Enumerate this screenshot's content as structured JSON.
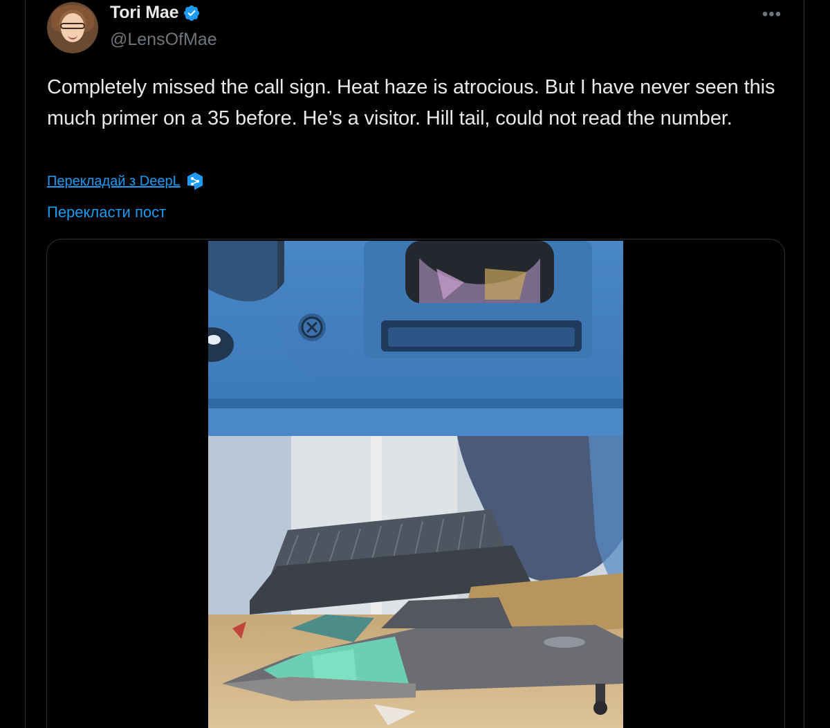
{
  "author": {
    "display_name": "Tori Mae",
    "handle": "@LensOfMae",
    "verified": true
  },
  "tweet": {
    "text": "Completely missed the call sign. Heat haze is atrocious. But I have never seen this much primer on a 35 before. He’s a visitor. Hill tail, could not read the number.",
    "deepl_link": "Перекладай з DeepL",
    "translate_post": "Перекласти пост"
  },
  "menu": {
    "more_icon": "more-horizontal-icon",
    "more_glyph": "•••"
  },
  "media": {
    "type": "video"
  },
  "colors": {
    "background": "#000000",
    "text": "#e7e9ea",
    "secondary_text": "#71767b",
    "link": "#1d9bf0",
    "border": "#2f3336",
    "verified_badge": "#1d9bf0"
  }
}
